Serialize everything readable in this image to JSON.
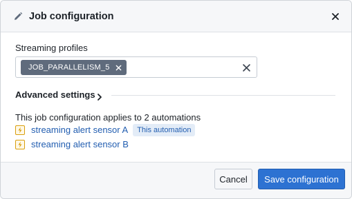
{
  "dialog": {
    "title": "Job configuration",
    "title_icon": "pencil-icon",
    "close_icon": "close-icon"
  },
  "streaming_profiles": {
    "label": "Streaming profiles",
    "tags": [
      {
        "label": "JOB_PARALLELISM_5",
        "remove_icon": "close-icon"
      }
    ],
    "clear_icon": "close-icon"
  },
  "advanced_settings": {
    "label": "Advanced settings",
    "expand_icon": "chevron-right-icon",
    "expanded": false
  },
  "automations": {
    "summary": "This job configuration applies to 2 automations",
    "items": [
      {
        "name": "streaming alert sensor A",
        "badge": "This automation",
        "icon": "automation-icon"
      },
      {
        "name": "streaming alert sensor B",
        "badge": "",
        "icon": "automation-icon"
      }
    ]
  },
  "footer": {
    "cancel_label": "Cancel",
    "save_label": "Save configuration"
  },
  "colors": {
    "primary": "#2d72d2",
    "link": "#215db0",
    "tag_background": "#5f6b7c",
    "badge_background": "#e3ecf7",
    "automation_icon": "#d99e0b"
  }
}
